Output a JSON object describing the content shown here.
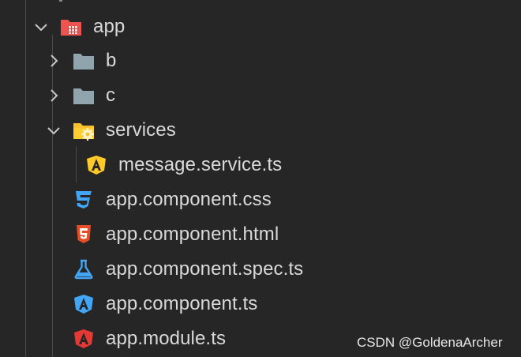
{
  "tree": {
    "items": [
      {
        "label": "app",
        "kind": "folder",
        "expanded": true,
        "icon": "app-folder-icon",
        "depth": 0
      },
      {
        "label": "b",
        "kind": "folder",
        "expanded": false,
        "icon": "folder-icon",
        "depth": 1
      },
      {
        "label": "c",
        "kind": "folder",
        "expanded": false,
        "icon": "folder-icon",
        "depth": 1
      },
      {
        "label": "services",
        "kind": "folder",
        "expanded": true,
        "icon": "services-folder-icon",
        "depth": 1
      },
      {
        "label": "message.service.ts",
        "kind": "file",
        "icon": "angular-service-icon",
        "depth": 2
      },
      {
        "label": "app.component.css",
        "kind": "file",
        "icon": "css3-icon",
        "depth": 1
      },
      {
        "label": "app.component.html",
        "kind": "file",
        "icon": "html5-icon",
        "depth": 1
      },
      {
        "label": "app.component.spec.ts",
        "kind": "file",
        "icon": "flask-test-icon",
        "depth": 1
      },
      {
        "label": "app.component.ts",
        "kind": "file",
        "icon": "angular-component-icon",
        "depth": 1
      },
      {
        "label": "app.module.ts",
        "kind": "file",
        "icon": "angular-module-icon",
        "depth": 1
      }
    ]
  },
  "watermark": "CSDN @GoldenaArcher",
  "colors": {
    "background": "#262626",
    "text": "#d9d9d9",
    "folder": "#90a4ae",
    "app_folder": "#ef5350",
    "services_folder": "#fbc02d",
    "angular_yellow": "#ffca28",
    "css_blue": "#42a5f5",
    "html_orange": "#e44d26",
    "angular_blue": "#42a5f5",
    "angular_red": "#e53935"
  }
}
